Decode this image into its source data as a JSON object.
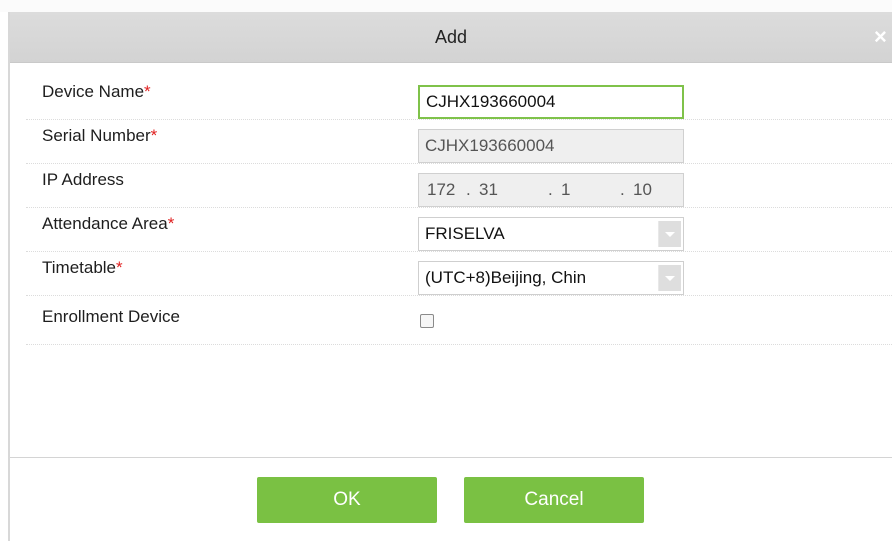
{
  "dialog": {
    "title": "Add",
    "close_glyph": "×",
    "required_marker": "*"
  },
  "form": {
    "device_name": {
      "label": "Device Name",
      "value": "CJHX193660004"
    },
    "serial_number": {
      "label": "Serial Number",
      "value": "CJHX193660004"
    },
    "ip_address": {
      "label": "IP Address",
      "octets": [
        "172",
        "31",
        "1",
        "10"
      ],
      "separator": "."
    },
    "attendance_area": {
      "label": "Attendance Area",
      "value": "FRISELVA"
    },
    "timetable": {
      "label": "Timetable",
      "value": "(UTC+8)Beijing, Chin"
    },
    "enrollment_device": {
      "label": "Enrollment Device",
      "checked": false
    }
  },
  "buttons": {
    "ok": "OK",
    "cancel": "Cancel"
  },
  "colors": {
    "accent": "#7ac143",
    "input_border": "#7fc24a",
    "required": "#e02020",
    "titlebar": "#d6d6d6"
  }
}
